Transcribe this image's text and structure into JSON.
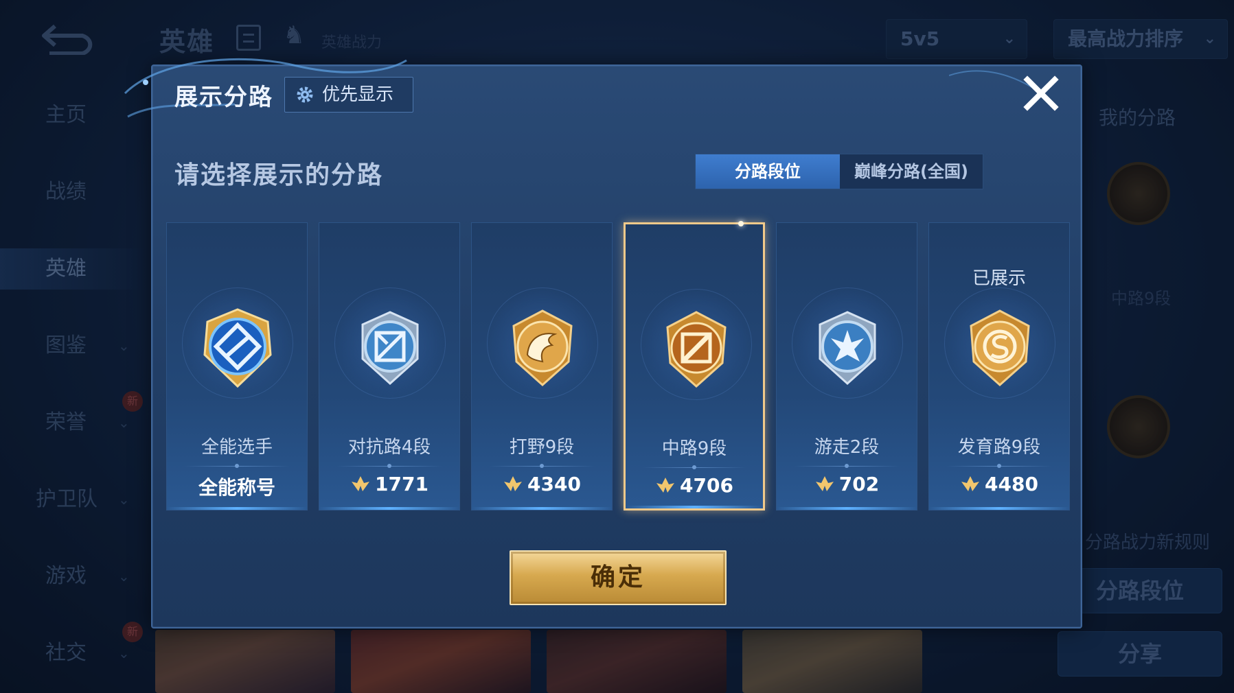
{
  "background": {
    "header": {
      "title": "英雄",
      "hero_power_label": "英雄战力",
      "mode_select": "5v5",
      "sort_select": "最高战力排序"
    },
    "sidebar": {
      "items": [
        {
          "label": "主页"
        },
        {
          "label": "战绩"
        },
        {
          "label": "英雄"
        },
        {
          "label": "图鉴"
        },
        {
          "label": "荣誉"
        },
        {
          "label": "护卫队"
        },
        {
          "label": "游戏"
        },
        {
          "label": "社交"
        }
      ],
      "new_badge": "新"
    },
    "right_panel": {
      "title": "我的分路",
      "lane_label": "中路9段",
      "rules_text": "分路战力新规则",
      "lane_rank_button": "分路段位",
      "share_button": "分享"
    }
  },
  "modal": {
    "title": "展示分路",
    "priority_button": "优先显示",
    "subtitle": "请选择展示的分路",
    "tabs": [
      {
        "label": "分路段位",
        "active": true
      },
      {
        "label": "巅峰分路(全国)",
        "active": false
      }
    ],
    "cards": [
      {
        "name": "全能选手",
        "score": "全能称号",
        "has_power_icon": false,
        "shown_label": "",
        "selected": false,
        "badge_icon": "all-round-badge-icon",
        "tone": "blue-gold"
      },
      {
        "name": "对抗路4段",
        "score": "1771",
        "has_power_icon": true,
        "shown_label": "",
        "selected": false,
        "badge_icon": "clash-lane-badge-icon",
        "tone": "silver"
      },
      {
        "name": "打野9段",
        "score": "4340",
        "has_power_icon": true,
        "shown_label": "",
        "selected": false,
        "badge_icon": "jungle-badge-icon",
        "tone": "gold"
      },
      {
        "name": "中路9段",
        "score": "4706",
        "has_power_icon": true,
        "shown_label": "",
        "selected": true,
        "badge_icon": "mid-lane-badge-icon",
        "tone": "gold"
      },
      {
        "name": "游走2段",
        "score": "702",
        "has_power_icon": true,
        "shown_label": "",
        "selected": false,
        "badge_icon": "roam-badge-icon",
        "tone": "silver"
      },
      {
        "name": "发育路9段",
        "score": "4480",
        "has_power_icon": true,
        "shown_label": "已展示",
        "selected": false,
        "badge_icon": "farm-lane-badge-icon",
        "tone": "gold"
      }
    ],
    "confirm_button": "确定"
  },
  "colors": {
    "accent_gold": "#f0c98a",
    "tab_active": "#3f7dcf",
    "modal_bg": "#2a4a75"
  }
}
